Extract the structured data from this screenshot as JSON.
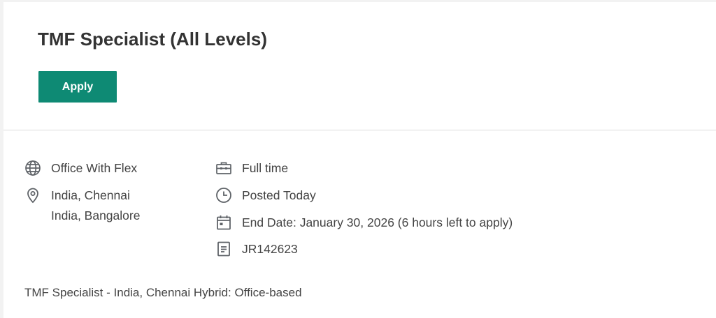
{
  "job": {
    "title": "TMF Specialist (All Levels)",
    "apply_label": "Apply"
  },
  "details": {
    "work_mode": "Office With Flex",
    "locations": [
      "India, Chennai",
      "India, Bangalore"
    ],
    "employment_type": "Full time",
    "posted": "Posted Today",
    "end_date": "End Date: January 30, 2026 (6 hours left to apply)",
    "requisition_id": "JR142623"
  },
  "summary": "TMF Specialist - India, Chennai Hybrid: Office-based",
  "icons": {
    "work_mode": "globe-icon",
    "location": "map-pin-icon",
    "employment_type": "briefcase-icon",
    "posted": "clock-icon",
    "end_date": "calendar-icon",
    "requisition_id": "document-icon"
  },
  "colors": {
    "accent": "#0e8a74",
    "icon": "#5f6368"
  }
}
